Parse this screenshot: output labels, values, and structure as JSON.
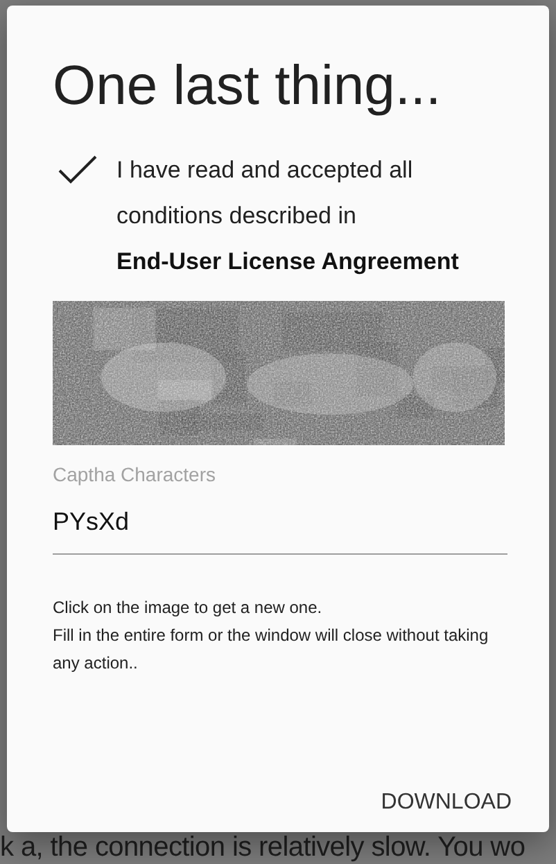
{
  "background": {
    "text": "k a, the connection is relatively slow. You wo"
  },
  "dialog": {
    "title": "One last thing...",
    "agreement": {
      "checked": true,
      "text": "I have read and accepted all conditions described in",
      "link": "End-User License Angreement"
    },
    "field": {
      "label": "Captha Characters",
      "value": "PYsXd"
    },
    "help": [
      "Click on the image to get a new one.",
      "Fill in the entire form or the window will close without taking any action.."
    ],
    "button": "DOWNLOAD"
  }
}
